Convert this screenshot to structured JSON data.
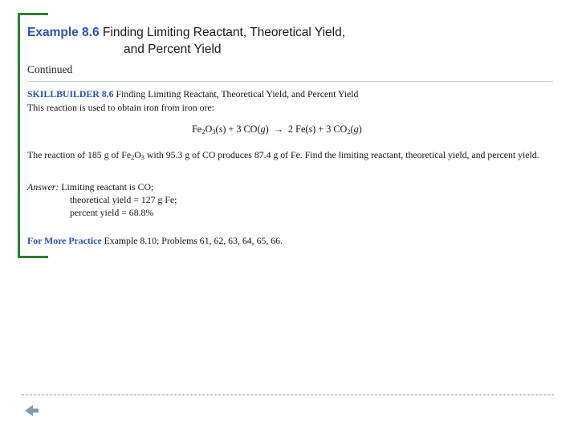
{
  "slide": {
    "header": {
      "example_label": "Example 8.6",
      "title_line1": "Finding Limiting Reactant, Theoretical Yield,",
      "title_line2": "and Percent Yield",
      "continued": "Continued"
    },
    "content": {
      "skillbuilder_label": "SKILLBUILDER 8.6",
      "skillbuilder_title": "Finding Limiting Reactant, Theoretical Yield, and Percent Yield",
      "intro": "This reaction is used to obtain iron from iron ore:",
      "equation": "Fe2O3(s) + 3 CO(g)  →  2 Fe(s) + 3 CO2(g)",
      "problem": "The reaction of 185 g of Fe2O3 with 95.3 g of CO produces 87.4 g of Fe. Find the limiting reactant, theoretical yield, and percent yield.",
      "answer_label": "Answer:",
      "answer_line1": "Limiting reactant is CO;",
      "answer_line2": "theoretical yield = 127 g Fe;",
      "answer_line3": "percent yield = 68.8%",
      "practice_label": "For More Practice",
      "practice_text": "Example 8.10; Problems 61, 62, 63, 64, 65, 66."
    },
    "colors": {
      "accent_blue": "#2a52be",
      "bracket_green": "#2e7d32",
      "rule_blue": "#7f9db9"
    }
  }
}
